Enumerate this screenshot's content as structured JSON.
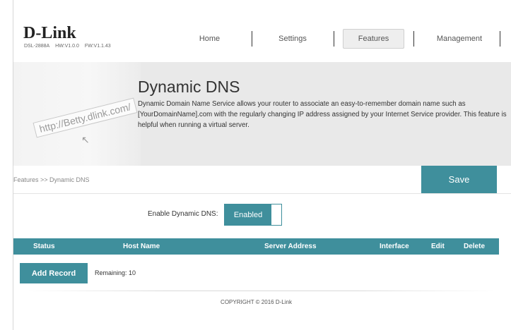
{
  "brand": {
    "logo": "D-Link",
    "model": "DSL-2888A",
    "hw": "HW:V1.0.0",
    "fw": "FW:V1.1.43"
  },
  "nav": {
    "home": "Home",
    "settings": "Settings",
    "features": "Features",
    "management": "Management",
    "active": "Features"
  },
  "banner": {
    "title": "Dynamic DNS",
    "description": "Dynamic Domain Name Service allows your router to associate an easy-to-remember domain name such as [YourDomainName].com with the regularly changing IP address assigned by your Internet Service provider. This feature is helpful when running a virtual server.",
    "illustration_text": "http://Betty.dlink.com/"
  },
  "breadcrumb": "Features >> Dynamic DNS",
  "save_label": "Save",
  "enable": {
    "label": "Enable Dynamic DNS:",
    "value": "Enabled"
  },
  "table": {
    "columns": [
      "Status",
      "Host Name",
      "Server Address",
      "Interface",
      "Edit",
      "Delete"
    ]
  },
  "add_record_label": "Add Record",
  "remaining": "Remaining: 10",
  "copyright": "COPYRIGHT © 2016 D-Link",
  "colors": {
    "accent": "#3f8f9c"
  }
}
